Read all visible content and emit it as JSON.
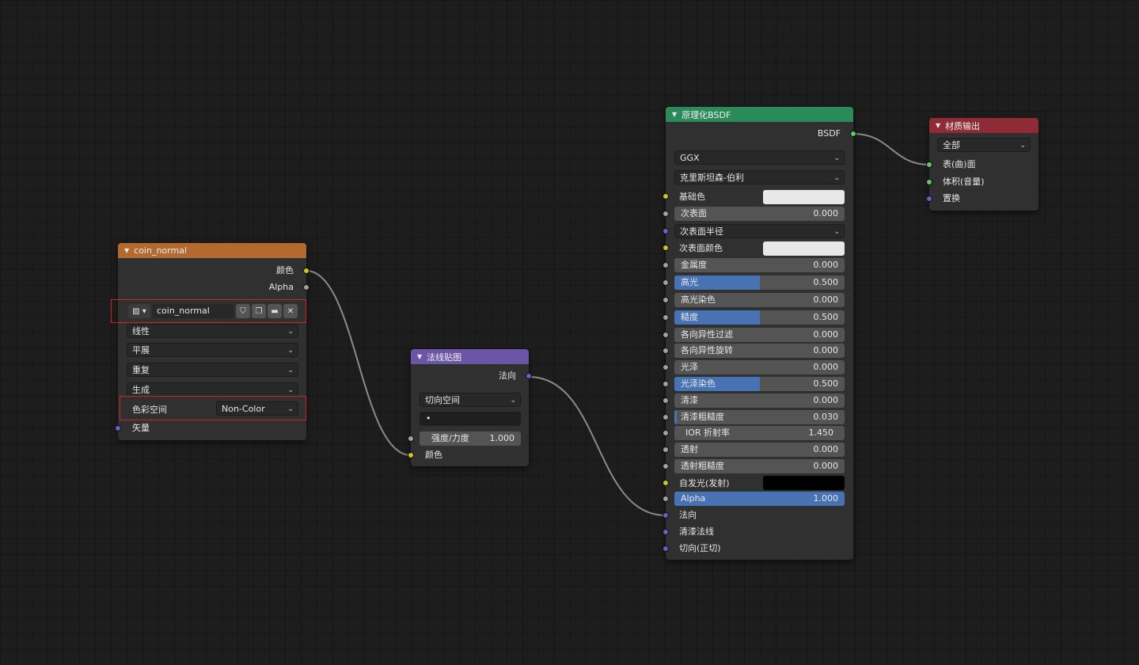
{
  "image_node": {
    "title": "coin_normal",
    "outputs": [
      "颜色",
      "Alpha"
    ],
    "image_name": "coin_normal",
    "interpolation": "线性",
    "projection": "平展",
    "extension": "重复",
    "source": "生成",
    "colorspace_label": "色彩空间",
    "colorspace_value": "Non-Color",
    "input_vector": "矢量",
    "header_color": "#b36a2f"
  },
  "normal_map_node": {
    "title": "法线贴图",
    "output": "法向",
    "space": "切向空间",
    "uv_map": "•",
    "strength_label": "强度/力度",
    "strength_value": "1.000",
    "input_color": "颜色",
    "header_color": "#6a55a6"
  },
  "bsdf_node": {
    "title": "原理化BSDF",
    "output": "BSDF",
    "distribution": "GGX",
    "subsurface_method": "克里斯坦森-伯利",
    "base_color_label": "基础色",
    "subsurface_radius_label": "次表面半径",
    "subsurface_color_label": "次表面颜色",
    "fields": [
      {
        "label": "次表面",
        "value": "0.000",
        "fill": 0
      },
      {
        "label": "金属度",
        "value": "0.000",
        "fill": 0
      },
      {
        "label": "高光",
        "value": "0.500",
        "fill": 0.5
      },
      {
        "label": "高光染色",
        "value": "0.000",
        "fill": 0
      },
      {
        "label": "糙度",
        "value": "0.500",
        "fill": 0.5
      },
      {
        "label": "各向异性过滤",
        "value": "0.000",
        "fill": 0
      },
      {
        "label": "各向异性旋转",
        "value": "0.000",
        "fill": 0
      },
      {
        "label": "光泽",
        "value": "0.000",
        "fill": 0
      },
      {
        "label": "光泽染色",
        "value": "0.500",
        "fill": 0.5
      },
      {
        "label": "清漆",
        "value": "0.000",
        "fill": 0
      },
      {
        "label": "清漆粗糙度",
        "value": "0.030",
        "fill": 0.03
      },
      {
        "label": "IOR 折射率",
        "value": "1.450",
        "fill": 0
      },
      {
        "label": "透射",
        "value": "0.000",
        "fill": 0
      },
      {
        "label": "透射粗糙度",
        "value": "0.000",
        "fill": 0
      }
    ],
    "emission_label": "自发光(发射)",
    "alpha_label": "Alpha",
    "alpha_value": "1.000",
    "inputs_tail": [
      "法向",
      "清漆法线",
      "切向(正切)"
    ],
    "header_color": "#2b8a5a"
  },
  "output_node": {
    "title": "材质输出",
    "target": "全部",
    "inputs": [
      "表(曲)面",
      "体积(音量)",
      "置换"
    ],
    "header_color": "#8f2b34"
  }
}
